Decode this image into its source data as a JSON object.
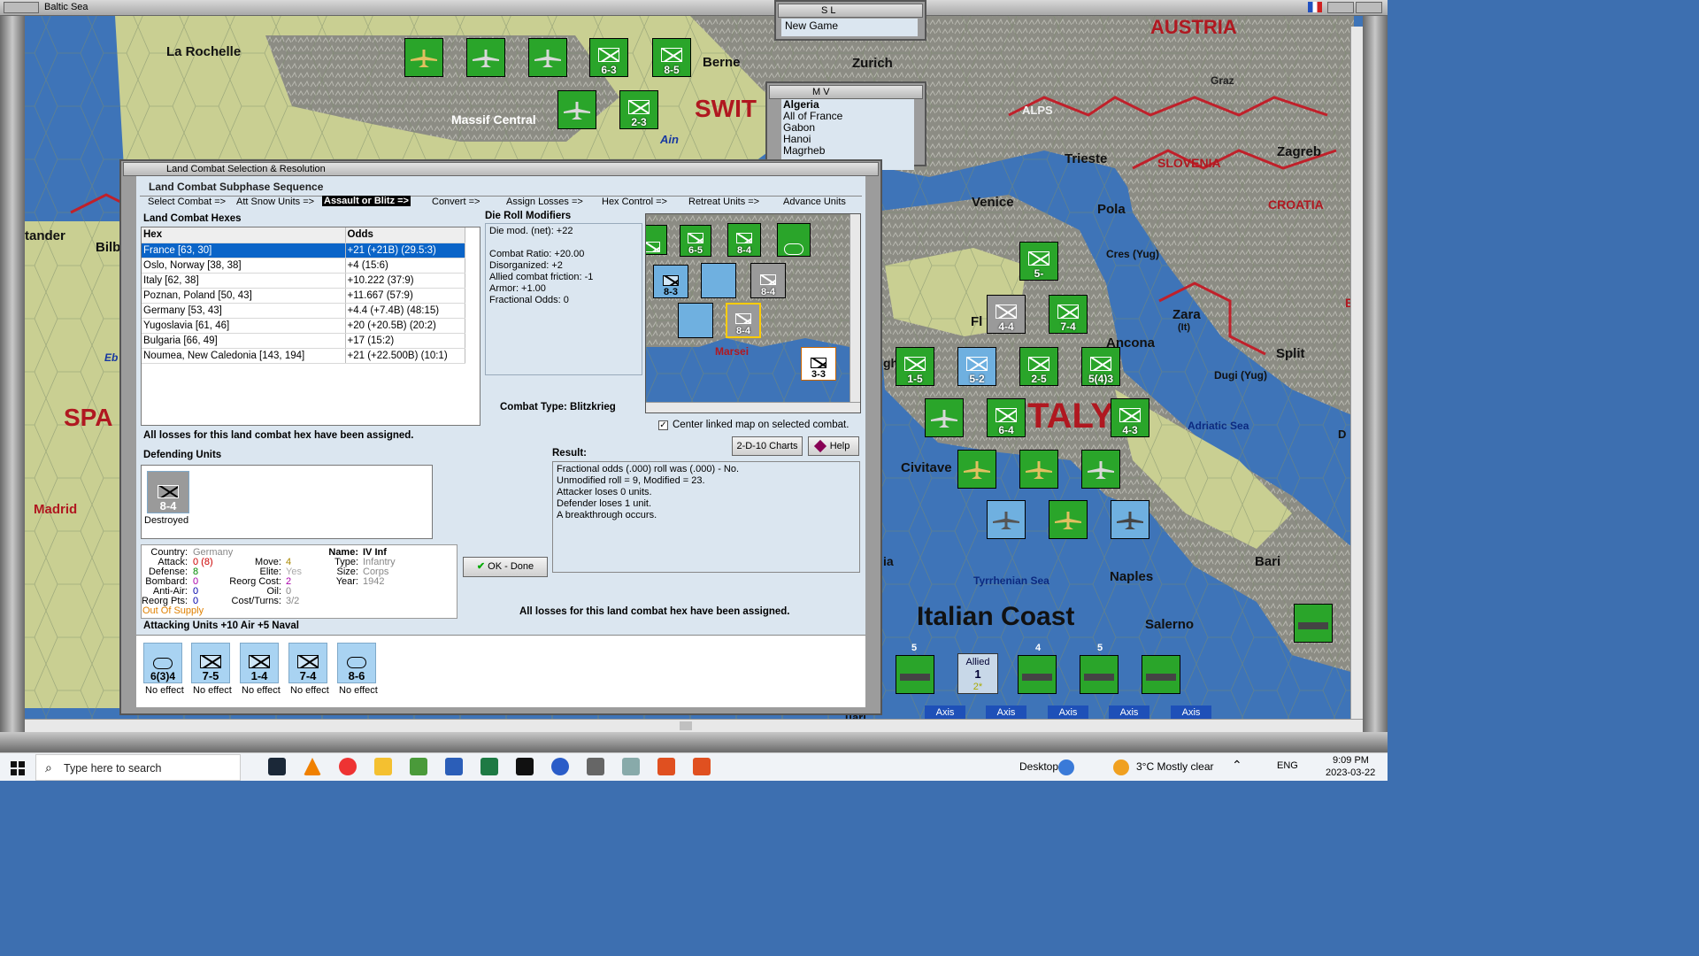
{
  "window_title": "Baltic Sea",
  "map": {
    "labels": {
      "la_rochelle": "La Rochelle",
      "berne": "Berne",
      "zurich": "Zurich",
      "massif_central": "Massif Central",
      "swit": "SWIT",
      "ain": "Ain",
      "austria": "AUSTRIA",
      "graz": "Graz",
      "alps": "ALPS",
      "trieste": "Trieste",
      "zagreb": "Zagreb",
      "slovenia": "SLOVENIA",
      "venice": "Venice",
      "pola": "Pola",
      "croatia": "CROATIA",
      "cres": "Cres (Yug)",
      "zara": "Zara",
      "zara_sub": "(It)",
      "bos": "BOS",
      "ancona": "Ancona",
      "split": "Split",
      "dugi": "Dugi (Yug)",
      "adriatic": "Adriatic Sea",
      "d": "D",
      "italy": "ITALY",
      "civitavecchia": "Civitave",
      "bari": "Bari",
      "naples": "Naples",
      "tyrrhenian": "Tyrrhenian Sea",
      "italian_coast": "Italian Coast",
      "salerno": "Salerno",
      "santander": "tander",
      "bilbao": "Bilb",
      "ebro": "Eb",
      "spain": "SPA",
      "madrid": "Madrid",
      "fl": "Fl",
      "gh": "gh",
      "ia": "ia",
      "ua": "uari"
    },
    "counters": [
      {
        "value": "6-3"
      },
      {
        "value": "8-5"
      },
      {
        "value": "2-3"
      },
      {
        "value": "5-"
      },
      {
        "value": "7-4"
      },
      {
        "value": "4-4"
      },
      {
        "value": "1-5"
      },
      {
        "value": "5-2"
      },
      {
        "value": "2-5"
      },
      {
        "value": "5(4)3"
      },
      {
        "value": "6-4"
      },
      {
        "value": "4-3"
      }
    ],
    "bottom_tabs": [
      "Axis",
      "Axis",
      "Axis",
      "Axis",
      "Axis"
    ],
    "allied_box": {
      "label": "Allied",
      "value": "1",
      "sub": "2*"
    },
    "unit_counts": [
      "5",
      "4",
      "5"
    ]
  },
  "sl_window": {
    "title": "S L",
    "item": "New Game"
  },
  "mv_window": {
    "title": "M V",
    "items": [
      "Algeria",
      "All of France",
      "Gabon",
      "Hanoi",
      "Magrheb"
    ]
  },
  "dialog": {
    "title": "Land Combat Selection & Resolution",
    "subphase_header": "Land Combat Subphase Sequence",
    "subphase_steps": [
      "Select Combat =>",
      "Att Snow Units =>",
      "Assault or Blitz =>",
      "Convert =>",
      "Assign Losses =>",
      "Hex Control =>",
      "Retreat Units =>",
      "Advance Units"
    ],
    "hexes_header": "Land Combat Hexes",
    "hex_col": "Hex",
    "odds_col": "Odds",
    "hexes": [
      {
        "hex": "France [63, 30]",
        "odds": "+21 (+21B) (29.5:3)"
      },
      {
        "hex": "Oslo, Norway [38, 38]",
        "odds": "+4 (15:6)"
      },
      {
        "hex": "Italy [62, 38]",
        "odds": "+10.222 (37:9)"
      },
      {
        "hex": "Poznan, Poland [50, 43]",
        "odds": "+11.667 (57:9)"
      },
      {
        "hex": "Germany [53, 43]",
        "odds": "+4.4 (+7.4B) (48:15)"
      },
      {
        "hex": "Yugoslavia [61, 46]",
        "odds": "+20 (+20.5B) (20:2)"
      },
      {
        "hex": "Bulgaria [66, 49]",
        "odds": "+17 (15:2)"
      },
      {
        "hex": "Noumea, New Caledonia [143, 194]",
        "odds": "+21 (+22.500B) (10:1)"
      }
    ],
    "drm_header": "Die Roll Modifiers",
    "drm_lines": [
      "Die mod. (net): +22",
      "",
      "Combat Ratio: +20.00",
      "Disorganized: +2",
      "Allied combat friction: -1",
      "Armor: +1.00",
      "Fractional Odds: 0"
    ],
    "combat_type": "Combat Type:  Blitzkrieg",
    "center_map": "Center linked map on selected combat.",
    "charts_btn": "2-D-10 Charts",
    "help_btn": "Help",
    "losses_msg": "All losses for this land combat hex have been assigned.",
    "defending_header": "Defending Units",
    "defender": {
      "value": "8-4",
      "status": "Destroyed"
    },
    "result_header": "Result:",
    "result_lines": [
      "Fractional odds (.000) roll was (.000)  - No.",
      "Unmodified roll = 9, Modified = 23.",
      "Attacker loses 0 units.",
      "Defender loses 1 unit.",
      "A breakthrough occurs."
    ],
    "unit_info": {
      "country_label": "Country:",
      "country": "Germany",
      "attack_label": "Attack:",
      "attack": "0 (8)",
      "defense_label": "Defense:",
      "defense": "8",
      "bombard_label": "Bombard:",
      "bombard": "0",
      "antiair_label": "Anti-Air:",
      "antiair": "0",
      "reorg_label": "Reorg Pts:",
      "reorg": "0",
      "supply": "Out Of Supply",
      "move_label": "Move:",
      "move": "4",
      "elite_label": "Elite:",
      "elite": "Yes",
      "reorgcost_label": "Reorg Cost:",
      "reorgcost": "2",
      "oil_label": "Oil:",
      "oil": "0",
      "costturns_label": "Cost/Turns:",
      "costturns": "3/2",
      "name_label": "Name:",
      "name": "IV Inf",
      "type_label": "Type:",
      "type": "Infantry",
      "size_label": "Size:",
      "size": "Corps",
      "year_label": "Year:",
      "year": "1942"
    },
    "ok_btn": "OK - Done",
    "attacking_header": "Attacking Units +10 Air +5 Naval",
    "attackers": [
      {
        "value": "6(3)4",
        "effect": "No effect"
      },
      {
        "value": "7-5",
        "effect": "No effect"
      },
      {
        "value": "1-4",
        "effect": "No effect"
      },
      {
        "value": "7-4",
        "effect": "No effect"
      },
      {
        "value": "8-6",
        "effect": "No effect"
      }
    ],
    "minimap_counters": [
      "8-4",
      "6-5",
      "8-3",
      "8-4",
      "8-4",
      "3-3"
    ],
    "minimap_label": "Marsei"
  },
  "taskbar": {
    "search_placeholder": "Type here to search",
    "desktop": "Desktop",
    "weather": "3°C  Mostly clear",
    "lang": "ENG",
    "time": "9:09 PM",
    "date": "2023-03-22"
  }
}
